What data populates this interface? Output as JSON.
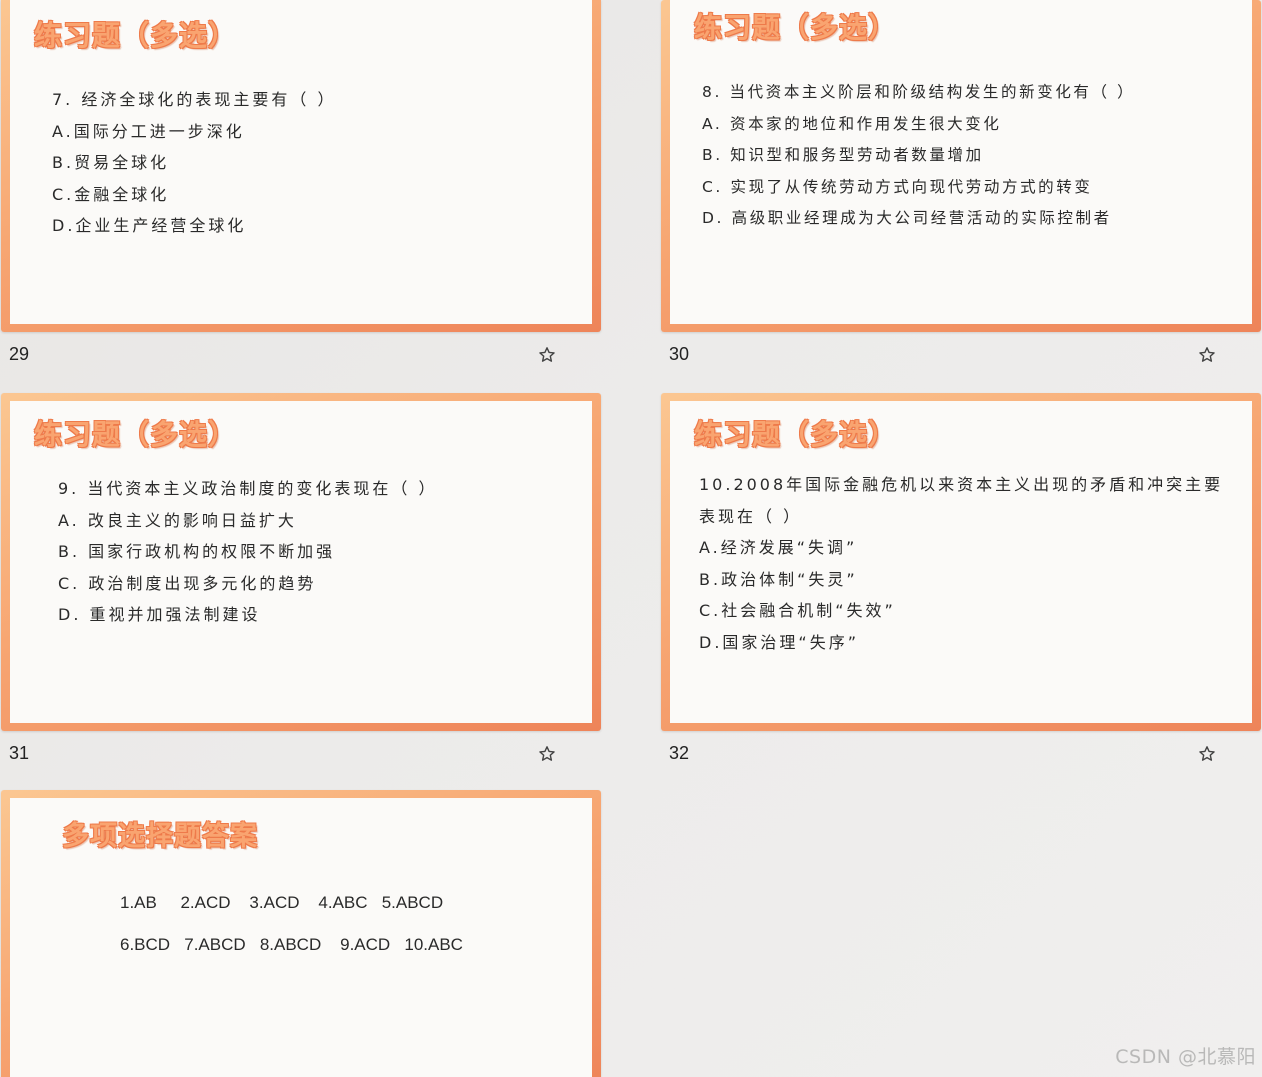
{
  "slides": [
    {
      "number": "29",
      "title": "练习题（多选）",
      "lines": [
        "7. 经济全球化的表现主要有（     ）",
        "A.国际分工进一步深化",
        "B.贸易全球化",
        "C.金融全球化",
        "D.企业生产经营全球化"
      ]
    },
    {
      "number": "30",
      "title": "练习题（多选）",
      "lines": [
        "8. 当代资本主义阶层和阶级结构发生的新变化有（     ）",
        "A. 资本家的地位和作用发生很大变化",
        "B. 知识型和服务型劳动者数量增加",
        "C. 实现了从传统劳动方式向现代劳动方式的转变",
        "D. 高级职业经理成为大公司经营活动的实际控制者"
      ]
    },
    {
      "number": "31",
      "title": "练习题（多选）",
      "lines": [
        "9. 当代资本主义政治制度的变化表现在（     ）",
        "A. 改良主义的影响日益扩大",
        "B. 国家行政机构的权限不断加强",
        "C. 政治制度出现多元化的趋势",
        "D. 重视并加强法制建设"
      ]
    },
    {
      "number": "32",
      "title": "练习题（多选）",
      "lines": [
        "10.2008年国际金融危机以来资本主义出现的矛盾和冲突主要表现在（     ）",
        "A.经济发展“失调”",
        "B.政治体制“失灵”",
        "C.社会融合机制“失效”",
        "D.国家治理“失序”"
      ]
    },
    {
      "number": "",
      "title": "多项选择题答案",
      "lines": [
        "1.AB     2.ACD    3.ACD    4.ABC   5.ABCD",
        "6.BCD   7.ABCD   8.ABCD    9.ACD   10.ABC"
      ]
    }
  ],
  "watermark": "CSDN @北慕阳",
  "icons": {
    "star": "star-outline-icon"
  },
  "colors": {
    "frame": "#f7a672",
    "title": "#f9a470",
    "title_outline": "#ee7a4a"
  }
}
